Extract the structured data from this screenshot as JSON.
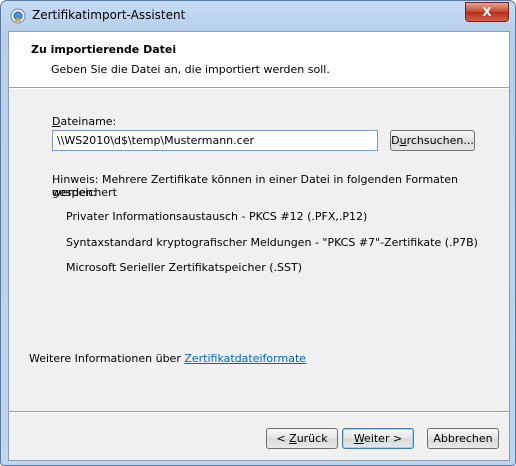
{
  "window": {
    "title": "Zertifikatimport-Assistent",
    "close_glyph": "X"
  },
  "header": {
    "title": "Zu importierende Datei",
    "subtitle": "Geben Sie die Datei an, die importiert werden soll."
  },
  "file": {
    "label_hot": "D",
    "label_rest": "ateiname:",
    "value": "\\\\WS2010\\d$\\temp\\Mustermann.cer",
    "browse_hot": "u",
    "browse_pre": "D",
    "browse_rest": "rchsuchen..."
  },
  "hint": {
    "line1": "Hinweis: Mehrere Zertifikate können in einer Datei in folgenden Formaten gespeichert",
    "line2": "werden:"
  },
  "formats": [
    "Privater Informationsaustausch - PKCS #12 (.PFX,.P12)",
    "Syntaxstandard kryptografischer Meldungen - \"PKCS #7\"-Zertifikate (.P7B)",
    "Microsoft Serieller Zertifikatspeicher (.SST)"
  ],
  "info": {
    "text": "Weitere Informationen über ",
    "link": "Zertifikatdateiformate"
  },
  "buttons": {
    "back_pre": "< ",
    "back_hot": "Z",
    "back_rest": "urück",
    "next_hot": "W",
    "next_rest": "eiter >",
    "cancel": "Abbrechen"
  }
}
